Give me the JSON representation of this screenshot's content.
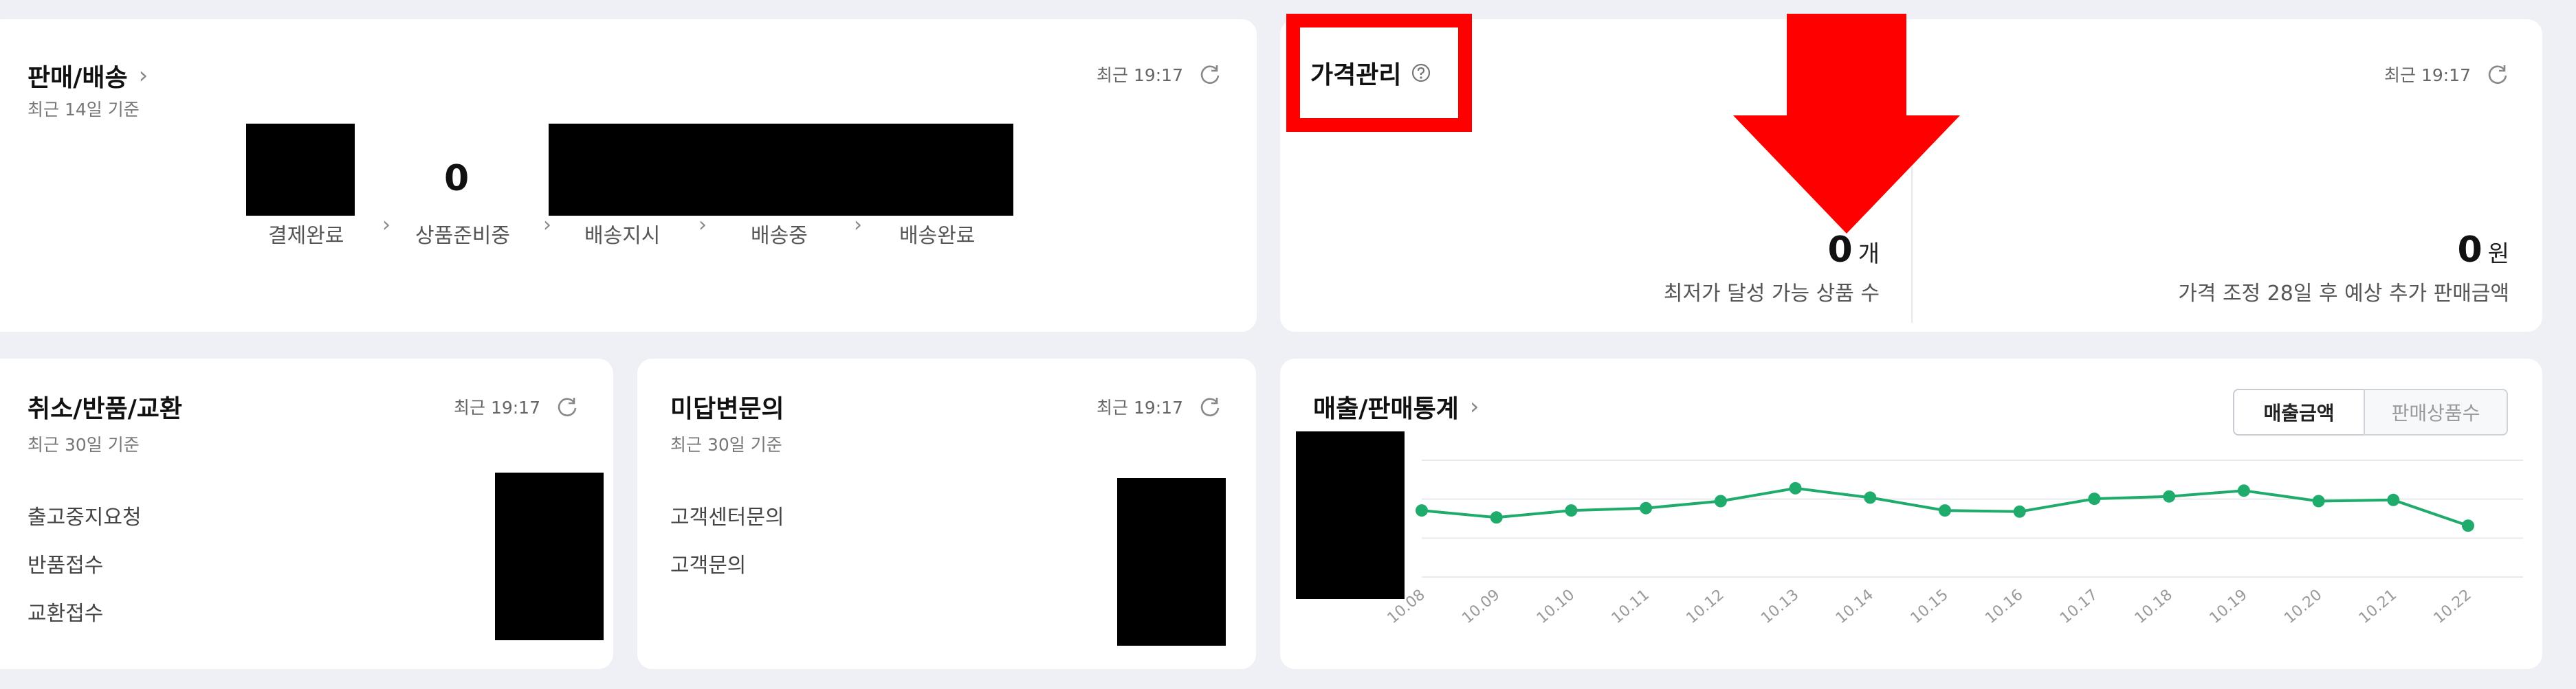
{
  "sales_delivery": {
    "title": "판매/배송",
    "subtitle": "최근 14일 기준",
    "recent": "최근 19:17",
    "count": "0",
    "steps": [
      "결제완료",
      "상품준비중",
      "배송지시",
      "배송중",
      "배송완료"
    ]
  },
  "price_mgmt": {
    "title": "가격관리",
    "recent": "최근 19:17",
    "left_value": "0",
    "left_unit": "개",
    "left_label": "최저가 달성 가능 상품 수",
    "right_value": "0",
    "right_unit": "원",
    "right_label": "가격 조정 28일 후 예상 추가 판매금액"
  },
  "cancel_return": {
    "title": "취소/반품/교환",
    "subtitle": "최근 30일 기준",
    "recent": "최근 19:17",
    "rows": [
      "출고중지요청",
      "반품접수",
      "교환접수"
    ]
  },
  "unanswered": {
    "title": "미답변문의",
    "subtitle": "최근 30일 기준",
    "recent": "최근 19:17",
    "rows": [
      "고객센터문의",
      "고객문의"
    ]
  },
  "sales_stats": {
    "title": "매출/판매통계",
    "tabs": [
      "매출금액",
      "판매상품수"
    ],
    "active_tab": "매출금액"
  },
  "chart_data": {
    "type": "line",
    "title": "",
    "x": [
      "10.08",
      "10.09",
      "10.10",
      "10.11",
      "10.12",
      "10.13",
      "10.14",
      "10.15",
      "10.16",
      "10.17",
      "10.18",
      "10.19",
      "10.20",
      "10.21",
      "10.22"
    ],
    "series": [
      {
        "values": [
          57,
          51,
          57,
          59,
          65,
          76,
          68,
          57,
          56,
          67,
          69,
          74,
          65,
          66,
          44
        ]
      }
    ],
    "ylim": [
      0,
      100
    ],
    "grid": true,
    "color": "#1fab6b"
  },
  "colors": {
    "accent_red": "#ff0000",
    "line_green": "#1fab6b"
  }
}
